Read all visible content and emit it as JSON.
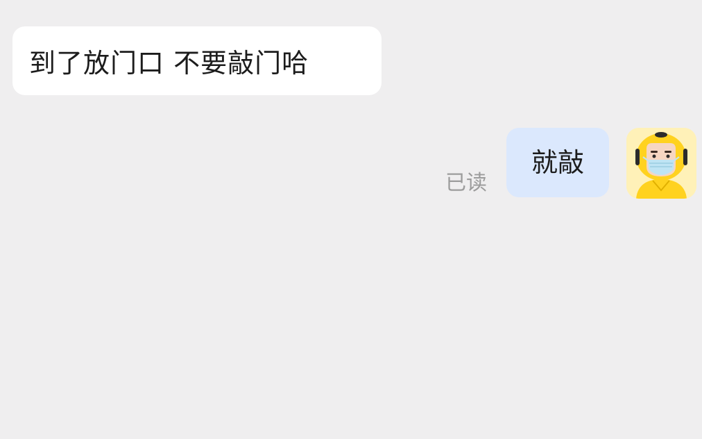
{
  "messages": {
    "incoming": {
      "text": "到了放门口 不要敲门哈"
    },
    "outgoing": {
      "text": "就敲",
      "status": "已读"
    }
  },
  "avatar": {
    "icon": "delivery-rider-avatar-icon"
  },
  "colors": {
    "background": "#efeeef",
    "incoming_bubble": "#ffffff",
    "outgoing_bubble": "#dbe8fd",
    "read_receipt": "#9c9c9c",
    "avatar_bg": "#fff1b8",
    "helmet": "#ffd21f"
  }
}
